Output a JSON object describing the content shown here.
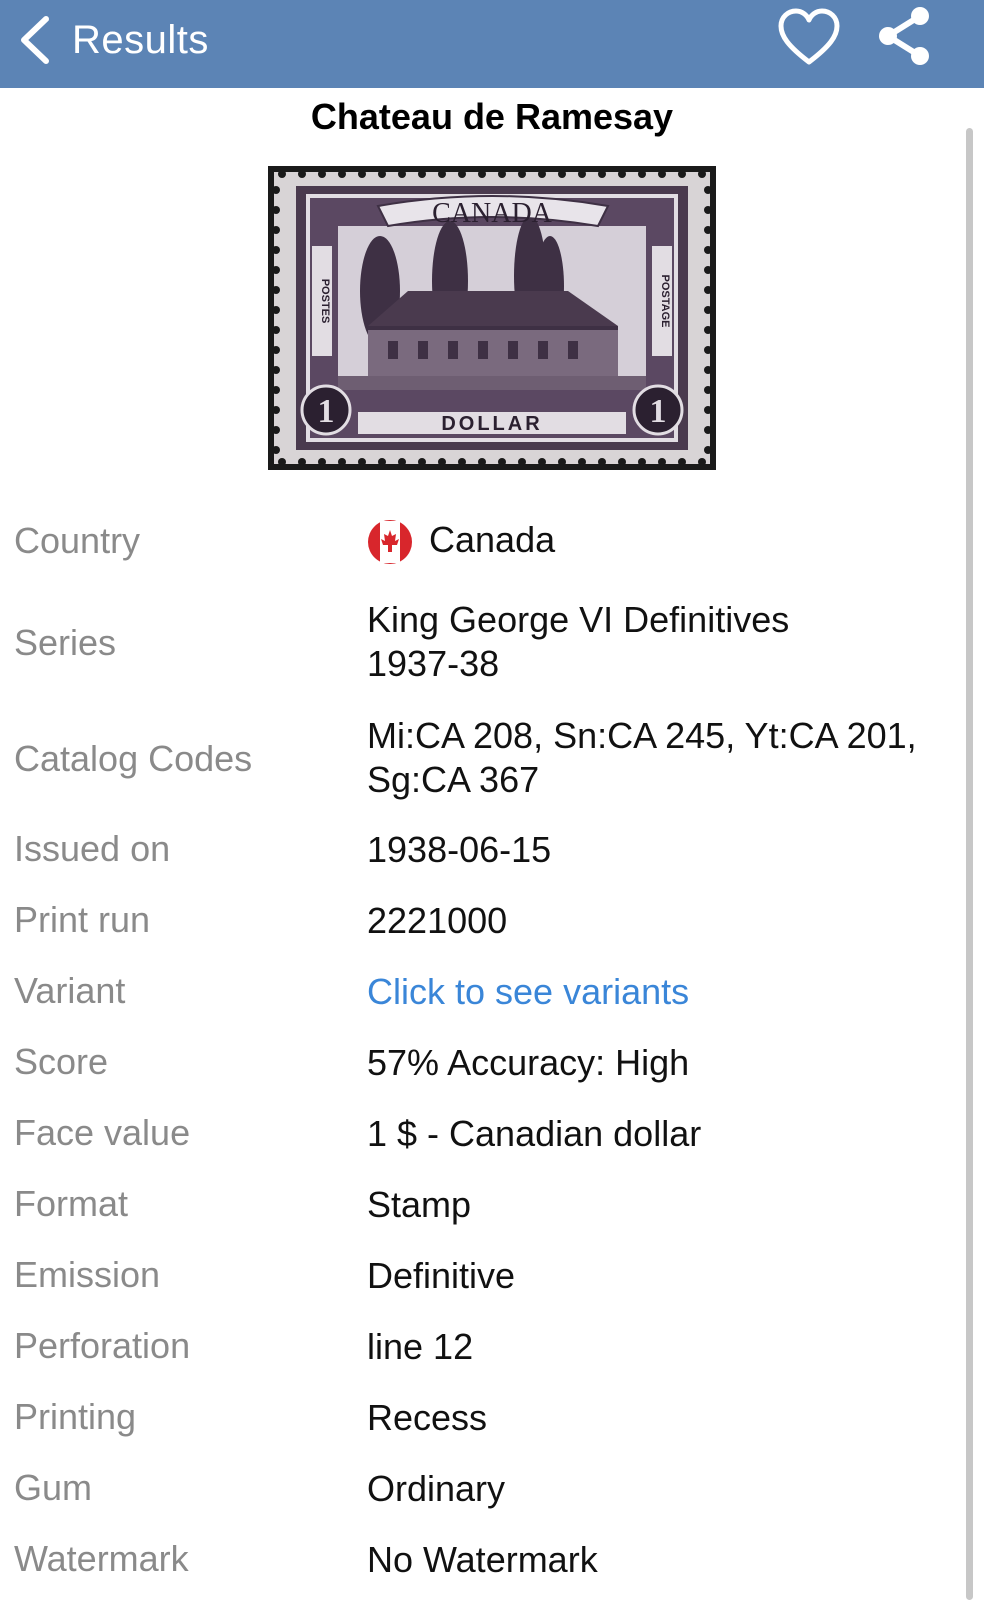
{
  "navbar": {
    "back_label": "Results",
    "back_icon": "chevron-left-icon",
    "favorite_icon": "heart-icon",
    "share_icon": "share-icon",
    "background_color": "#5c84b5"
  },
  "title": "Chateau de Ramesay",
  "stamp": {
    "top_text": "CANADA",
    "left_text": "POSTES",
    "right_text": "POSTAGE",
    "bottom_text": "DOLLAR",
    "denomination": "1"
  },
  "details": {
    "country": {
      "label": "Country",
      "value": "Canada",
      "icon": "canada-flag-icon"
    },
    "series": {
      "label": "Series",
      "value_line1": "King George VI Definitives",
      "value_line2": "1937-38"
    },
    "catalog_codes": {
      "label": "Catalog Codes",
      "value_line1": "Mi:CA 208, Sn:CA 245, Yt:CA 201,",
      "value_line2": "Sg:CA 367"
    },
    "issued_on": {
      "label": "Issued on",
      "value": "1938-06-15"
    },
    "print_run": {
      "label": "Print run",
      "value": "2221000"
    },
    "variant": {
      "label": "Variant",
      "value": "Click to see variants",
      "link_color": "#3a86d8"
    },
    "score": {
      "label": "Score",
      "value": "57% Accuracy: High"
    },
    "face_value": {
      "label": "Face value",
      "value": "1 $ - Canadian dollar"
    },
    "format": {
      "label": "Format",
      "value": "Stamp"
    },
    "emission": {
      "label": "Emission",
      "value": "Definitive"
    },
    "perforation": {
      "label": "Perforation",
      "value": "line 12"
    },
    "printing": {
      "label": "Printing",
      "value": "Recess"
    },
    "gum": {
      "label": "Gum",
      "value": "Ordinary"
    },
    "watermark": {
      "label": "Watermark",
      "value": "No Watermark"
    }
  }
}
